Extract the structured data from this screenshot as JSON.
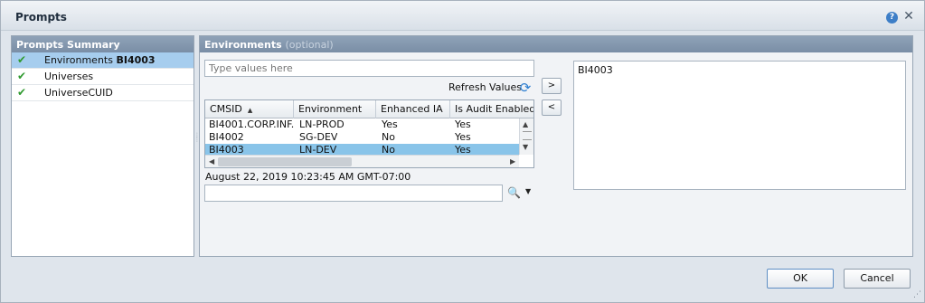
{
  "dialog": {
    "title": "Prompts",
    "help_icon": "help-icon",
    "close_icon": "close-icon"
  },
  "summary": {
    "header": "Prompts Summary",
    "items": [
      {
        "label": "Environments",
        "value": "BI4003",
        "icon": "check-icon"
      },
      {
        "label": "Universes",
        "icon": "check-icon"
      },
      {
        "label": "UniverseCUID",
        "icon": "check-icon"
      }
    ]
  },
  "environments": {
    "header": "Environments",
    "optional": "(optional)",
    "input_placeholder": "Type values here",
    "refresh_label": "Refresh Values",
    "add_label": ">",
    "remove_label": "<",
    "columns": [
      "CMSID",
      "Environment",
      "Enhanced IA",
      "Is Audit Enabled"
    ],
    "sort_indicator": "▲",
    "rows": [
      [
        "BI4001.CORP.INF...",
        "LN-PROD",
        "Yes",
        "Yes"
      ],
      [
        "BI4002",
        "SG-DEV",
        "No",
        "Yes"
      ],
      [
        "BI4003",
        "LN-DEV",
        "No",
        "Yes"
      ]
    ],
    "timestamp": "August 22, 2019 10:23:45 AM GMT-07:00",
    "search_value": "",
    "selected_values": [
      "BI4003"
    ]
  },
  "footer": {
    "ok_label": "OK",
    "cancel_label": "Cancel"
  },
  "colors": {
    "selection": "#a6cdee",
    "panel_header": "#8fa2b8",
    "check": "#2f9a2f"
  }
}
